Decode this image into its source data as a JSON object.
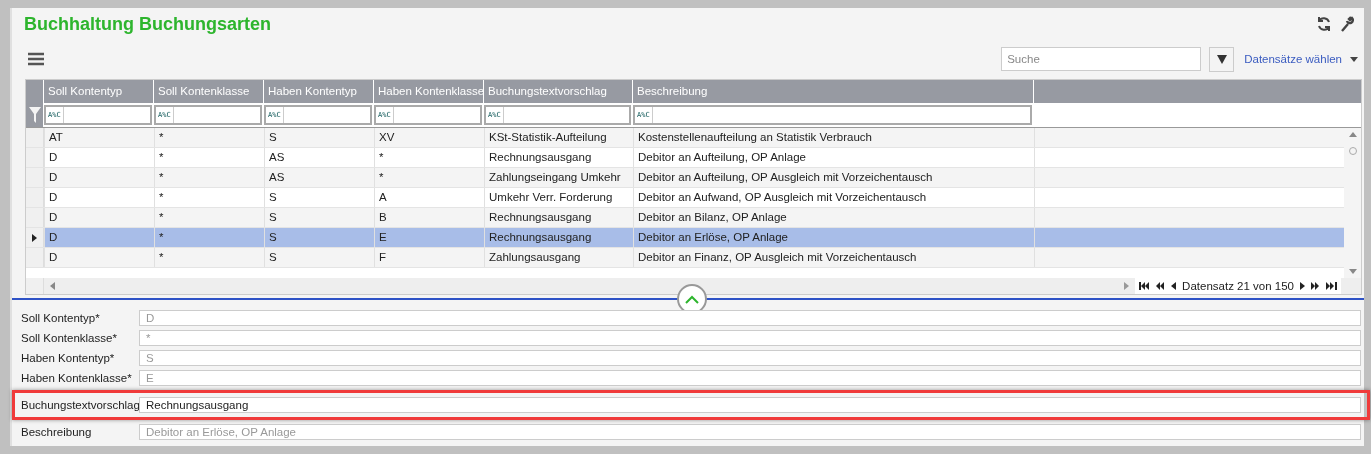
{
  "window": {
    "title": "Buchhaltung Buchungsarten"
  },
  "toolbar": {
    "search": {
      "placeholder": "Suche"
    },
    "records_menu": "Datensätze wählen"
  },
  "table": {
    "columns": [
      {
        "label": "Soll Kontentyp",
        "filter_mode": "A%C"
      },
      {
        "label": "Soll Kontenklasse",
        "filter_mode": "A%C"
      },
      {
        "label": "Haben Kontentyp",
        "filter_mode": "A%C"
      },
      {
        "label": "Haben Kontenklasse",
        "filter_mode": "A%C"
      },
      {
        "label": "Buchungstextvorschlag",
        "filter_mode": "A%C"
      },
      {
        "label": "Beschreibung",
        "filter_mode": "A%C"
      }
    ],
    "rows": [
      {
        "selected": false,
        "cells": [
          "AT",
          "*",
          "S",
          "XV",
          "KSt-Statistik-Aufteilung",
          "Kostenstellenaufteilung an Statistik Verbrauch"
        ]
      },
      {
        "selected": false,
        "cells": [
          "D",
          "*",
          "AS",
          "*",
          "Rechnungsausgang",
          "Debitor an Aufteilung, OP Anlage"
        ]
      },
      {
        "selected": false,
        "cells": [
          "D",
          "*",
          "AS",
          "*",
          "Zahlungseingang Umkehr",
          "Debitor an Aufteilung, OP Ausgleich mit Vorzeichentausch"
        ]
      },
      {
        "selected": false,
        "cells": [
          "D",
          "*",
          "S",
          "A",
          "Umkehr Verr. Forderung",
          "Debitor an Aufwand, OP Ausgleich mit Vorzeichentausch"
        ]
      },
      {
        "selected": false,
        "cells": [
          "D",
          "*",
          "S",
          "B",
          "Rechnungsausgang",
          "Debitor an Bilanz, OP Anlage"
        ]
      },
      {
        "selected": true,
        "cells": [
          "D",
          "*",
          "S",
          "E",
          "Rechnungsausgang",
          "Debitor an Erlöse, OP Anlage"
        ]
      },
      {
        "selected": false,
        "cells": [
          "D",
          "*",
          "S",
          "F",
          "Zahlungsausgang",
          "Debitor an Finanz, OP Ausgleich mit Vorzeichentausch"
        ]
      }
    ],
    "pager": "Datensatz 21 von 150"
  },
  "form": {
    "fields": [
      {
        "label": "Soll Kontentyp*",
        "value": "D",
        "highlighted": false,
        "disabled": true
      },
      {
        "label": "Soll Kontenklasse*",
        "value": "*",
        "highlighted": false,
        "disabled": true
      },
      {
        "label": "Haben Kontentyp*",
        "value": "S",
        "highlighted": false,
        "disabled": true
      },
      {
        "label": "Haben Kontenklasse*",
        "value": "E",
        "highlighted": false,
        "disabled": true
      },
      {
        "label": "Buchungstextvorschlag",
        "value": "Rechnungsausgang",
        "highlighted": true,
        "disabled": false
      },
      {
        "label": "Beschreibung",
        "value": "Debitor an Erlöse, OP Anlage",
        "highlighted": false,
        "disabled": true
      }
    ]
  }
}
